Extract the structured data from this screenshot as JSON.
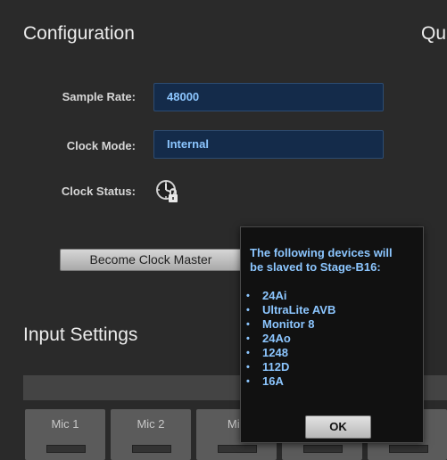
{
  "configuration": {
    "title": "Configuration",
    "sample_rate_label": "Sample Rate:",
    "sample_rate_value": "48000",
    "clock_mode_label": "Clock Mode:",
    "clock_mode_value": "Internal",
    "clock_status_label": "Clock Status:",
    "clock_status_icon": "clock-locked-icon",
    "become_clock_master_label": "Become Clock Master"
  },
  "right_section_title_partial": "Qu",
  "input_settings": {
    "title": "Input Settings",
    "channels": [
      "Mic 1",
      "Mic 2",
      "Mic",
      "",
      ""
    ]
  },
  "popup": {
    "message_line1": "The following devices will",
    "message_line2": "be slaved to Stage-B16:",
    "devices": [
      "24Ai",
      "UltraLite AVB",
      "Monitor 8",
      "24Ao",
      "1248",
      "112D",
      "16A"
    ],
    "ok_label": "OK"
  },
  "colors": {
    "background": "#2a2a2a",
    "field_bg": "#142b4a",
    "accent_text": "#8cc6ff",
    "popup_bg": "#111111"
  }
}
